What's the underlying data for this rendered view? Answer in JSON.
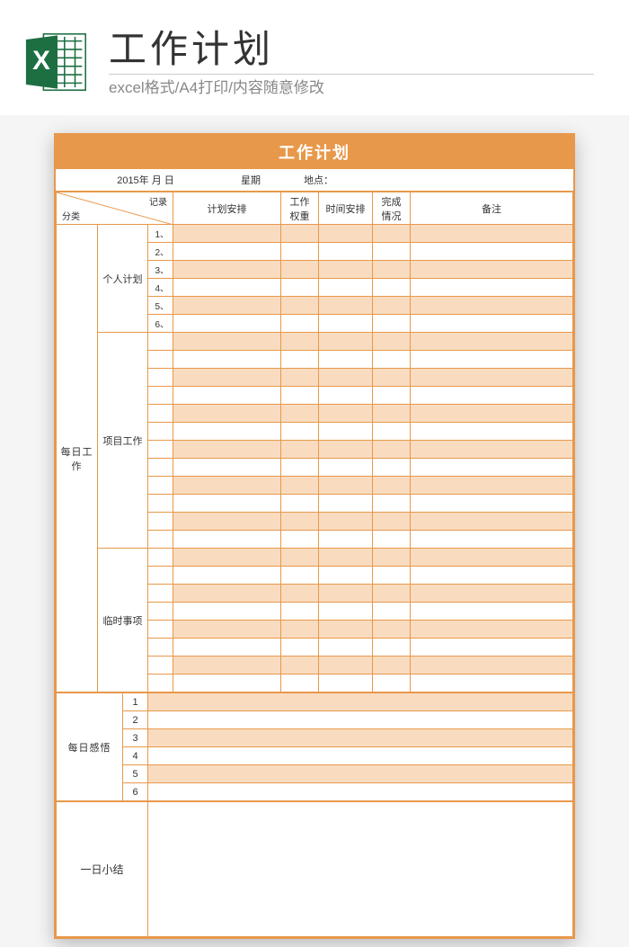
{
  "header": {
    "title": "工作计划",
    "subtitle": "excel格式/A4打印/内容随意修改",
    "icon_letter": "X"
  },
  "sheet": {
    "title": "工作计划",
    "date_label": "2015年 月 日",
    "weekday_label": "星期",
    "location_label": "地点：",
    "diag_top": "记录",
    "diag_bottom": "分类",
    "columns": {
      "plan": "计划安排",
      "weight": "工作\n权重",
      "time": "时间安排",
      "done": "完成\n情况",
      "remark": "备注"
    },
    "sections": {
      "daily_work": "每日工作",
      "personal_plan": "个人计划",
      "project_work": "项目工作",
      "temp_items": "临时事项",
      "daily_thoughts": "每日感悟",
      "day_summary": "一日小结"
    },
    "personal_rows": [
      "1、",
      "2、",
      "3、",
      "4、",
      "5、",
      "6、"
    ],
    "project_row_count": 12,
    "temp_row_count": 8,
    "thoughts_rows": [
      "1",
      "2",
      "3",
      "4",
      "5",
      "6"
    ]
  }
}
